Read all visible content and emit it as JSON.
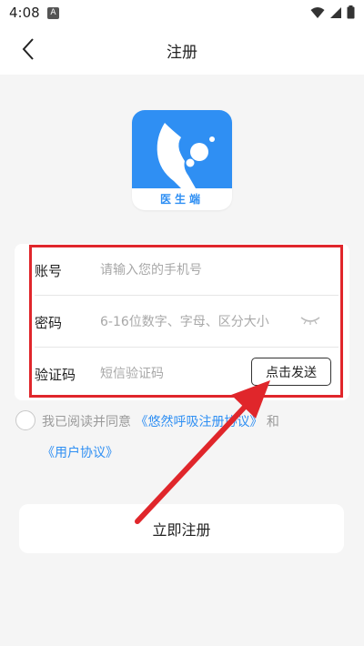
{
  "status_bar": {
    "time": "4:08",
    "notification_letter": "A"
  },
  "header": {
    "title": "注册",
    "back_icon": "chevron-left-icon"
  },
  "logo": {
    "label": "医生端",
    "brand_color": "#2f8ff3"
  },
  "form": {
    "account": {
      "label": "账号",
      "placeholder": "请输入您的手机号",
      "value": ""
    },
    "password": {
      "label": "密码",
      "placeholder": "6-16位数字、字母、区分大小",
      "value": "",
      "toggle_icon": "eye-closed-icon"
    },
    "verification": {
      "label": "验证码",
      "placeholder": "短信验证码",
      "value": "",
      "send_button": "点击发送"
    }
  },
  "agreement": {
    "prefix": "我已阅读并同意",
    "link1": "《悠然呼吸注册协议》",
    "connector": "和",
    "link2": "《用户协议》",
    "checked": false
  },
  "register_button": "立即注册",
  "annotation": {
    "highlight_color": "#e0262b"
  }
}
